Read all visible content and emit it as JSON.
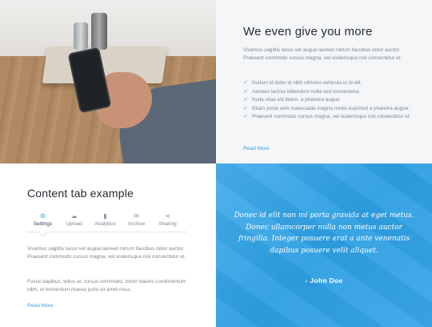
{
  "top_right": {
    "title": "We even give you more",
    "intro": "Vivamus sagittis lacus vel augue laoreet rutrum faucibus dolor auctor. Praesent commodo cursus magna, vel scelerisque nisl consectetur et.",
    "checklist": [
      "Nullam id dolor id nibh ultricies vehicula ut id elit.",
      "Aenean lacinia bibendum nulla sed consectetur.",
      "Nulla vitae elit libero, a pharetra augue.",
      "Etiam porta sem malesuada magna mollis euismod a pharetra augue.",
      "Praesent commodo cursus magna, vel scelerisque nisl consectetur et."
    ],
    "read_more": "Read More",
    "check_icon": "check-icon"
  },
  "content_tabs": {
    "title": "Content tab example",
    "tabs": [
      {
        "label": "Settings",
        "icon": "gear-icon",
        "active": true
      },
      {
        "label": "Upload",
        "icon": "cloud-upload-icon",
        "active": false
      },
      {
        "label": "Analytics",
        "icon": "bar-chart-icon",
        "active": false
      },
      {
        "label": "Archive",
        "icon": "envelope-icon",
        "active": false
      },
      {
        "label": "Sharing",
        "icon": "share-icon",
        "active": false
      }
    ],
    "paragraph1": "Vivamus sagittis lacus vel augue laoreet rutrum faucibus dolor auctor. Praesent commodo cursus magna, vel scelerisque nisl consectetur et.",
    "paragraph2": "Fusce dapibus, tellus ac cursus commodo, tortor mauris condimentum nibh, ut fermentum massa justo sit amet risus.",
    "read_more": "Read More"
  },
  "testimonial": {
    "quote": "Donec id elit non mi porta gravida at eget metus. Donec ullamcorper nulla non metus auctor fringilla. Integer posuere erat a ante venenatis dapibus posuere velit aliquet.",
    "author": "- John Doe"
  },
  "colors": {
    "accent": "#3aa3e2",
    "heading": "#252b33",
    "body_text": "#7c8893",
    "panel_bg": "#f5f6f8",
    "quote_bg": "#2d9ee2"
  }
}
